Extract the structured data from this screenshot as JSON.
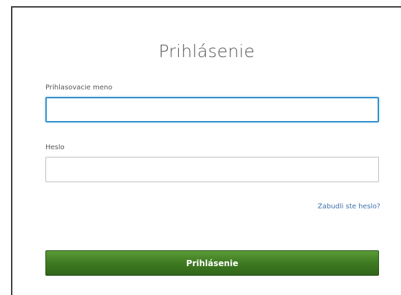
{
  "form": {
    "title": "Prihlásenie",
    "username_label": "Prihlasovacie meno",
    "username_value": "",
    "password_label": "Heslo",
    "password_value": "",
    "forgot_link": "Zabudli ste heslo?",
    "submit_label": "Prihlásenie"
  },
  "colors": {
    "button_green": "#3f7a22",
    "focus_border": "#2f8ecb",
    "link_blue": "#3f6fae"
  }
}
